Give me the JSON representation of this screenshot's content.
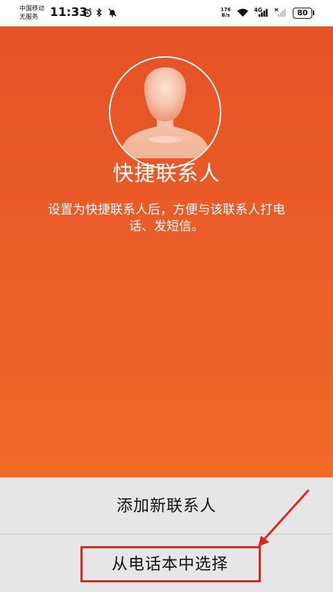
{
  "status_bar": {
    "carrier_line1": "中国移动",
    "carrier_line2": "无服务",
    "time": "11:33",
    "net_speed_value": "176",
    "net_speed_unit": "B/s",
    "network_type": "4G",
    "battery_level": "80"
  },
  "hero": {
    "title": "快捷联系人",
    "description": "设置为快捷联系人后，方便与该联系人打电话、发短信。",
    "background_top": "#e45226",
    "background_bottom": "#f16a28"
  },
  "actions": {
    "add_new_contact_label": "添加新联系人",
    "choose_from_phonebook_label": "从电话本中选择"
  },
  "annotation": {
    "highlight_color": "#e0201b"
  }
}
